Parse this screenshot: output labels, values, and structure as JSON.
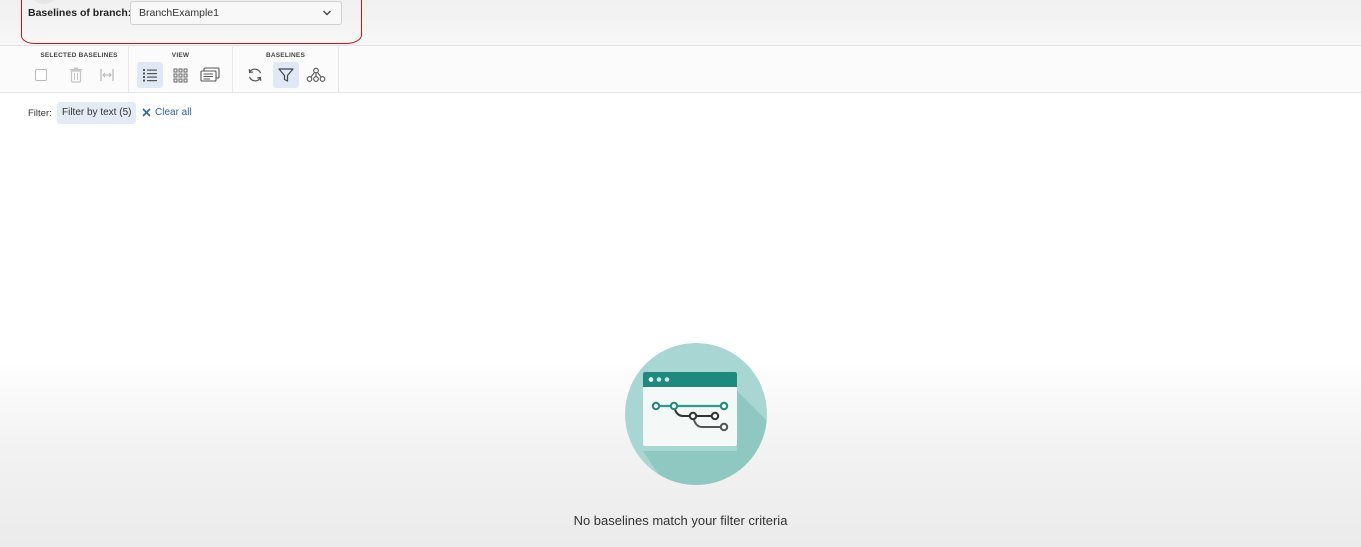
{
  "header": {
    "branch_label": "Baselines of branch:",
    "branch_select_value": "BranchExample1"
  },
  "toolbar": {
    "groups": [
      {
        "title": "SELECTED BASELINES",
        "buttons": [
          "select-all-checkbox",
          "trash-icon",
          "compare-icon"
        ]
      },
      {
        "title": "VIEW",
        "buttons": [
          "list-view-icon",
          "grid-view-icon",
          "comments-view-icon"
        ]
      },
      {
        "title": "BASELINES",
        "buttons": [
          "refresh-icon",
          "filter-icon",
          "branches-icon"
        ]
      }
    ]
  },
  "filter": {
    "label": "Filter:",
    "chip": "Filter by text (5)",
    "clear_all": "Clear all"
  },
  "empty_state": {
    "message": "No baselines match your filter criteria"
  },
  "colors": {
    "accent": "#2a63b6",
    "chip_bg": "#e4ebf4",
    "annotation": "#c8161e",
    "illustration_circle": "#a8d6d2",
    "illustration_teal": "#1e8a7e"
  }
}
